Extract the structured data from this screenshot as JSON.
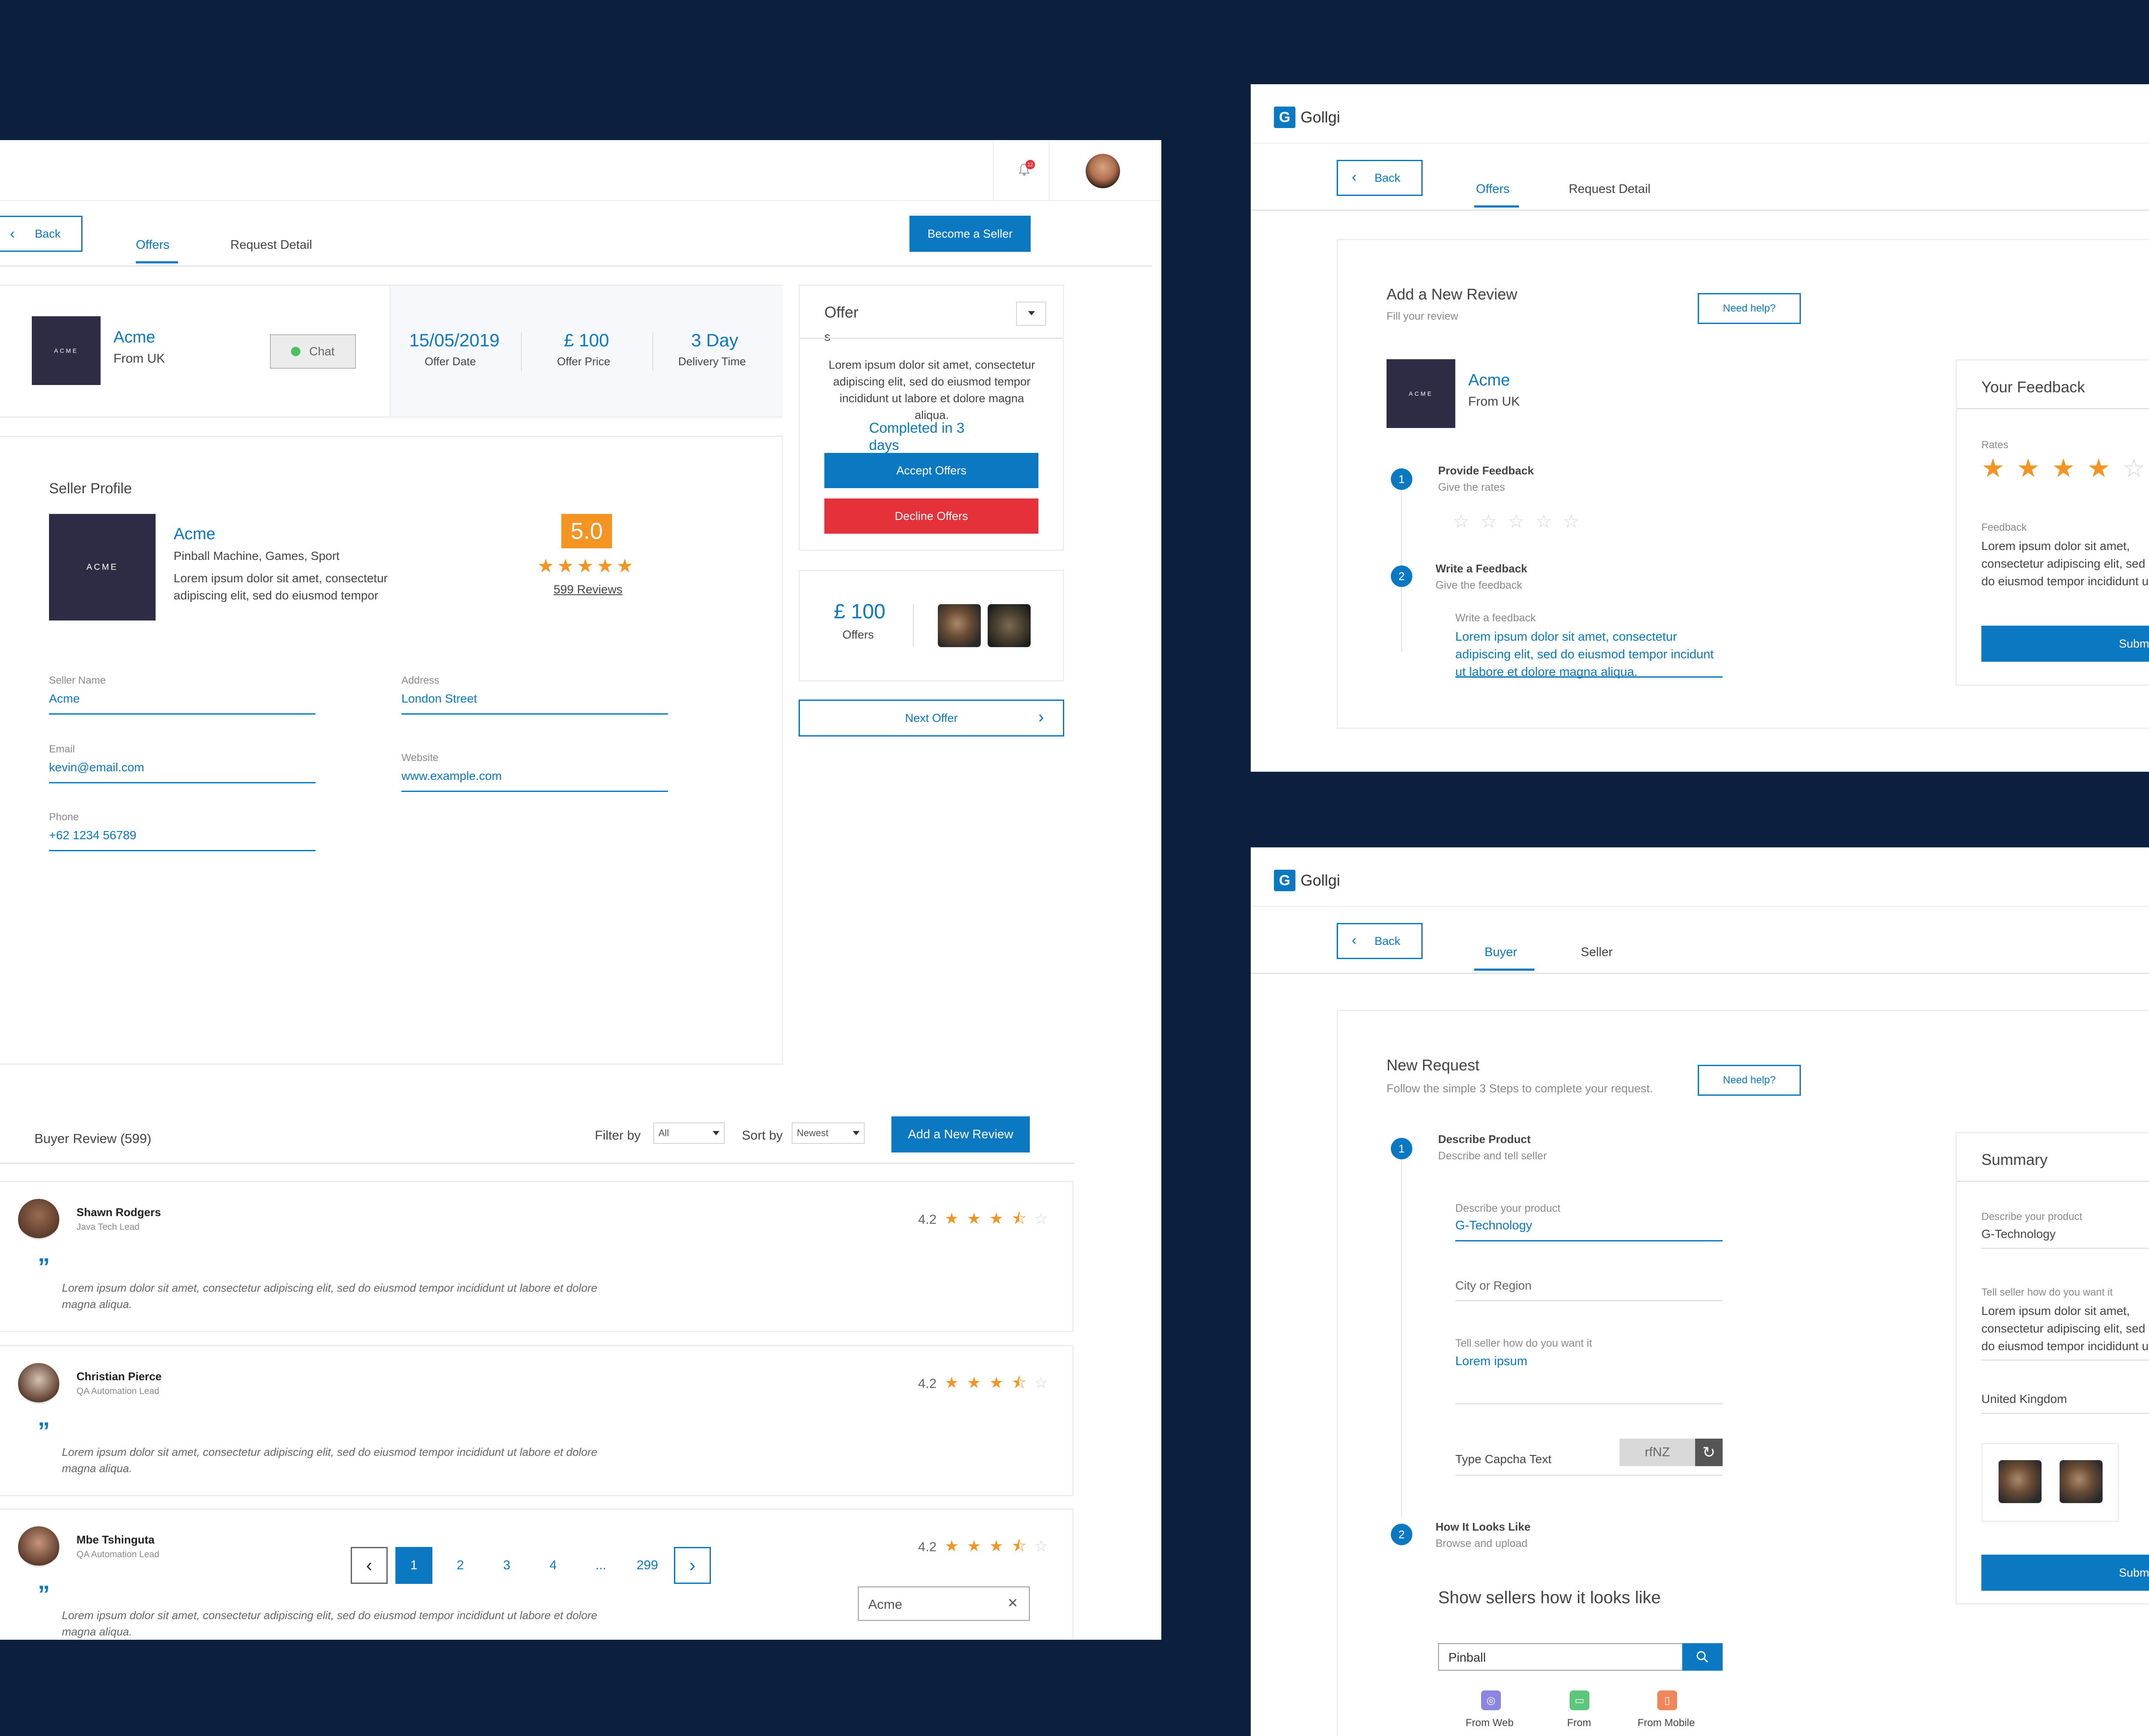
{
  "main": {
    "notification_count": "12",
    "back": "Back",
    "tabs": [
      "Offers",
      "Request Detail"
    ],
    "become_seller": "Become a Seller",
    "summary": {
      "logo_text": "ACME",
      "name": "Acme",
      "from": "From UK",
      "chat": "Chat",
      "offer_date_value": "15/05/2019",
      "offer_date_label": "Offer Date",
      "offer_price_value": "£ 100",
      "offer_price_label": "Offer Price",
      "delivery_value": "3 Day",
      "delivery_label": "Delivery Time"
    },
    "offer_card": {
      "title": "Offer",
      "sub": "s",
      "description": "Lorem ipsum dolor sit amet, consectetur adipiscing elit, sed do eiusmod tempor incididunt ut labore et dolore magna aliqua.",
      "completed": "Completed in 3 days",
      "accept": "Accept Offers",
      "decline": "Decline Offers"
    },
    "offers_box": {
      "price": "£ 100",
      "label": "Offers"
    },
    "next_offer": "Next Offer",
    "seller_profile": {
      "heading": "Seller Profile",
      "logo_text": "ACME",
      "name": "Acme",
      "categories": "Pinball Machine, Games, Sport",
      "description": "Lorem ipsum dolor sit amet, consectetur adipiscing elit, sed do eiusmod tempor",
      "rating": "5.0",
      "reviews_link": "599 Reviews",
      "seller_name_label": "Seller Name",
      "seller_name_value": "Acme",
      "address_label": "Address",
      "address_value": "London Street",
      "email_label": "Email",
      "email_value": "kevin@email.com",
      "website_label": "Website",
      "website_value": "www.example.com",
      "phone_label": "Phone",
      "phone_value": "+62 1234 56789"
    },
    "reviews_header": {
      "title": "Buyer Review (599)",
      "filter_label": "Filter by",
      "filter_value": "All",
      "sort_label": "Sort by",
      "sort_value": "Newest",
      "add_review": "Add a New Review"
    },
    "reviews": [
      {
        "name": "Shawn Rodgers",
        "role": "Java Tech Lead",
        "rating": "4.2",
        "stars": 3.5,
        "text": "Lorem ipsum dolor sit amet, consectetur adipiscing elit, sed do eiusmod tempor incididunt ut labore et dolore magna aliqua."
      },
      {
        "name": "Christian Pierce",
        "role": "QA Automation Lead",
        "rating": "4.2",
        "stars": 3.5,
        "text": "Lorem ipsum dolor sit amet, consectetur adipiscing elit, sed do eiusmod tempor incididunt ut labore et dolore magna aliqua."
      },
      {
        "name": "Mbe Tshinguta",
        "role": "QA Automation Lead",
        "rating": "4.2",
        "stars": 3.5,
        "text": "Lorem ipsum dolor sit amet, consectetur adipiscing elit, sed do eiusmod tempor incididunt ut labore et dolore magna aliqua."
      }
    ],
    "pagination": [
      "1",
      "2",
      "3",
      "4",
      "...",
      "299"
    ],
    "chip": "Acme"
  },
  "review_panel": {
    "brand": "Gollgi",
    "back": "Back",
    "tabs": [
      "Offers",
      "Request Detail"
    ],
    "title": "Add a New Review",
    "subtitle": "Fill your review",
    "need_help": "Need help?",
    "logo_text": "ACME",
    "name": "Acme",
    "from": "From UK",
    "step1_title": "Provide Feedback",
    "step1_sub": "Give the rates",
    "step2_title": "Write a Feedback",
    "step2_sub": "Give the feedback",
    "write_label": "Write a feedback",
    "write_value": "Lorem ipsum dolor sit amet, consectetur adipiscing elit, sed do eiusmod tempor incidunt ut labore et dolore magna aliqua.",
    "side": {
      "title": "Your Feedback",
      "rates_label": "Rates",
      "feedback_label": "Feedback",
      "feedback_value": "Lorem ipsum dolor sit amet, consectetur adipiscing elit, sed do eiusmod tempor incididunt ut labore et dolore magna aliqua.",
      "submit": "Submit",
      "stars": 4
    }
  },
  "request_panel": {
    "brand": "Gollgi",
    "back": "Back",
    "tabs": [
      "Buyer",
      "Seller"
    ],
    "title": "New Request",
    "subtitle": "Follow the simple 3 Steps to complete your request.",
    "need_help": "Need help?",
    "step1_title": "Describe Product",
    "step1_sub": "Describe and tell seller",
    "product_label": "Describe your product",
    "product_value": "G-Technology",
    "city_placeholder": "City or Region",
    "tell_label": "Tell seller how do you want it",
    "tell_value": "Lorem ipsum",
    "captcha_label": "Type Capcha Text",
    "captcha_value": "rfNZ",
    "step2_title": "How It Looks Like",
    "step2_sub": "Browse and upload",
    "show_heading": "Show sellers how it looks like",
    "search_value": "Pinball",
    "sources": [
      "From Web",
      "From",
      "From Mobile"
    ],
    "side": {
      "title": "Summary",
      "product_label": "Describe your product",
      "product_value": "G-Technology",
      "tell_label": "Tell seller how do you want it",
      "tell_value": "Lorem ipsum dolor sit amet, consectetur adipiscing elit, sed do eiusmod tempor incididunt ut labore et dolore magna aliqua.",
      "country": "United Kingdom",
      "submit": "Submit"
    }
  },
  "colors": {
    "background": "#0c1f3f",
    "accent": "#0b78c2",
    "danger": "#e5323a",
    "star": "#f39423",
    "rating_badge": "#f39423"
  }
}
